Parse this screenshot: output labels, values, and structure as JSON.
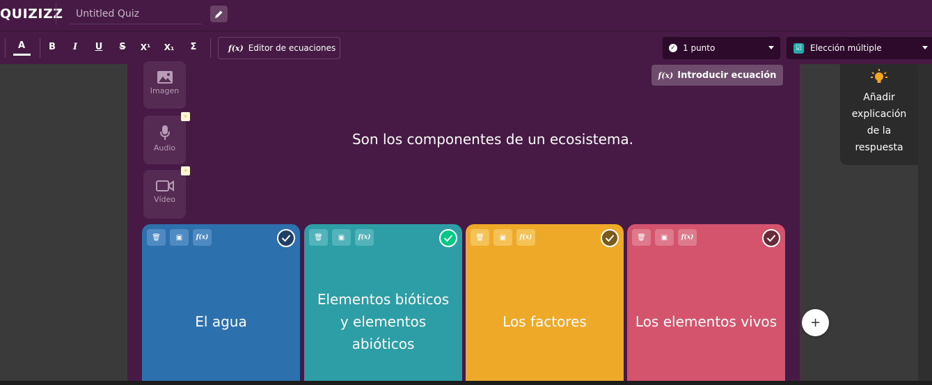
{
  "app": {
    "logo": "QUIZIZZ",
    "quiz_title": "Untitled Quiz"
  },
  "toolbar": {
    "color_label": "A",
    "bold": "B",
    "italic": "I",
    "underline": "U",
    "strike": "S",
    "superscript": "X¹",
    "subscript": "X₁",
    "sigma": "Σ",
    "equation_editor": "Editor de ecuaciones",
    "points": "1 punto",
    "question_type": "Elección múltiple"
  },
  "media": {
    "image": "Imagen",
    "audio": "Audio",
    "video": "Vídeo"
  },
  "insert_equation": "Introducir ecuación",
  "question": "Son los componentes de un ecosistema.",
  "answers": [
    {
      "text": "El agua",
      "color": "#2d70ae",
      "tool_color": "#4f8bc2",
      "check_color": "#1f3f63"
    },
    {
      "text": "Elementos bióticos y elementos abióticos",
      "color": "#2d9da6",
      "tool_color": "#52b3bb",
      "check_color": "#00c985"
    },
    {
      "text": "Los factores",
      "color": "#efa929",
      "tool_color": "#f5c257",
      "check_color": "#7a5a18"
    },
    {
      "text": "Los elementos vivos",
      "color": "#d5546d",
      "tool_color": "#df7a8d",
      "check_color": "#6b2a37"
    }
  ],
  "explanation": {
    "line1": "Añadir",
    "line2": "explicación",
    "line3": "de la",
    "line4": "respuesta"
  },
  "add_label": "+"
}
